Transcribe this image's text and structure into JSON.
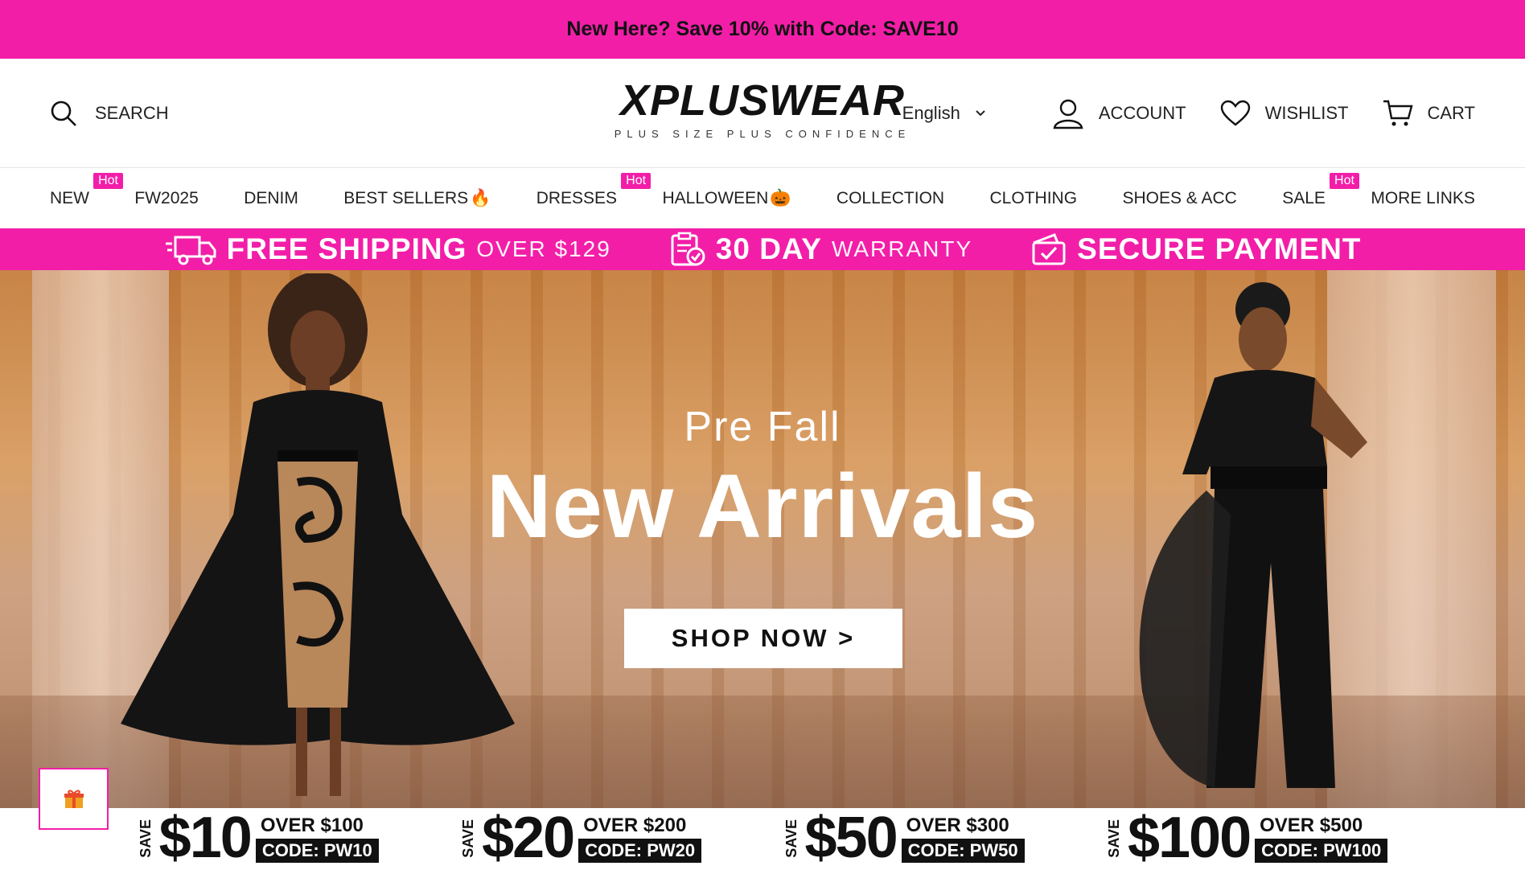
{
  "announcement": "New Here? Save 10% with Code: SAVE10",
  "header": {
    "search_label": "SEARCH",
    "logo_text": "XPLUSWEAR",
    "logo_tagline": "PLUS SIZE PLUS CONFIDENCE",
    "language": "English",
    "account_label": "ACCOUNT",
    "wishlist_label": "WISHLIST",
    "cart_label": "CART"
  },
  "nav": {
    "items": [
      {
        "label": "NEW",
        "badge": "Hot"
      },
      {
        "label": "FW2025"
      },
      {
        "label": "DENIM"
      },
      {
        "label": "BEST SELLERS",
        "emoji": "🔥"
      },
      {
        "label": "DRESSES",
        "badge": "Hot"
      },
      {
        "label": "HALLOWEEN",
        "emoji": "🎃"
      },
      {
        "label": "COLLECTION"
      },
      {
        "label": "CLOTHING"
      },
      {
        "label": "SHOES & ACC"
      },
      {
        "label": "SALE",
        "badge": "Hot"
      },
      {
        "label": "MORE LINKS"
      }
    ]
  },
  "perks": [
    {
      "strong": "FREE SHIPPING",
      "light": "OVER $129",
      "icon": "truck-icon"
    },
    {
      "strong": "30 DAY",
      "light": "WARRANTY",
      "icon": "clipboard-icon"
    },
    {
      "strong": "SECURE PAYMENT",
      "light": "",
      "icon": "secure-check-icon"
    }
  ],
  "hero": {
    "subtitle": "Pre Fall",
    "title": "New Arrivals",
    "cta": "SHOP NOW >"
  },
  "coupons": [
    {
      "save": "SAVE",
      "amount": "$10",
      "over": "OVER $100",
      "code": "CODE: PW10"
    },
    {
      "save": "SAVE",
      "amount": "$20",
      "over": "OVER $200",
      "code": "CODE: PW20"
    },
    {
      "save": "SAVE",
      "amount": "$50",
      "over": "OVER $300",
      "code": "CODE: PW50"
    },
    {
      "save": "SAVE",
      "amount": "$100",
      "over": "OVER $500",
      "code": "CODE: PW100"
    }
  ],
  "colors": {
    "brand_pink": "#f21ea8"
  }
}
